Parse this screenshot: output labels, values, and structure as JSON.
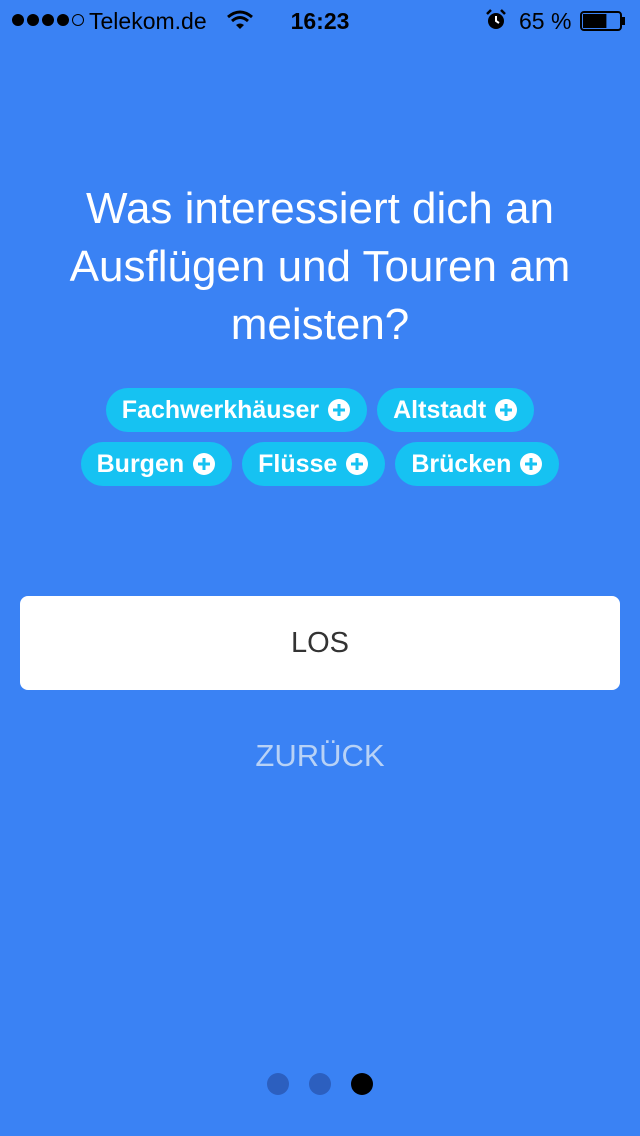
{
  "status_bar": {
    "carrier": "Telekom.de",
    "time": "16:23",
    "battery_percent": "65 %",
    "battery_level": 0.65,
    "signal_bars": 4,
    "signal_max": 5,
    "icons": [
      "wifi-icon",
      "alarm-icon",
      "battery-icon"
    ]
  },
  "question": "Was interessiert dich an Ausflügen und Touren am meisten?",
  "chips": [
    {
      "label": "Fachwerkhäuser",
      "icon": "plus-circle-icon"
    },
    {
      "label": "Altstadt",
      "icon": "plus-circle-icon"
    },
    {
      "label": "Burgen",
      "icon": "plus-circle-icon"
    },
    {
      "label": "Flüsse",
      "icon": "plus-circle-icon"
    },
    {
      "label": "Brücken",
      "icon": "plus-circle-icon"
    }
  ],
  "primary_button": "LOS",
  "secondary_button": "ZURÜCK",
  "page_indicator": {
    "count": 3,
    "active": 3
  },
  "colors": {
    "background": "#3a82f4",
    "chip": "#16c2f2",
    "secondary_text": "#b8d2f6",
    "inactive_dot": "#2c5fbf"
  }
}
